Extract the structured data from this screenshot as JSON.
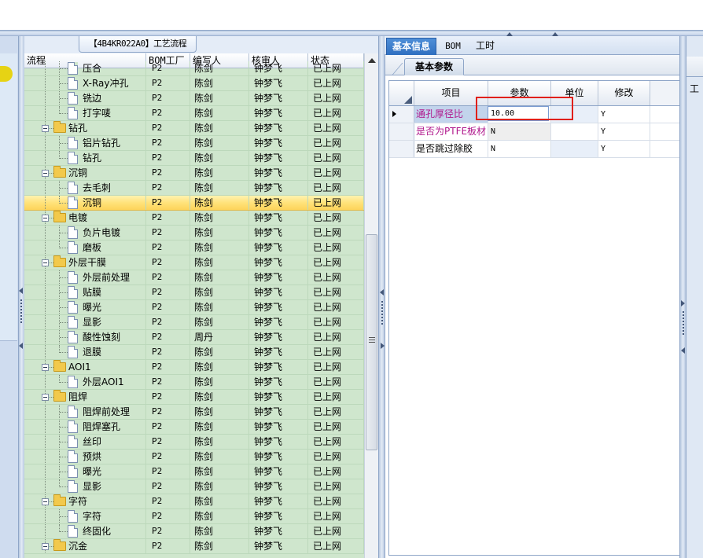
{
  "tree_panel": {
    "title": "【4B4KR022A0】工艺流程",
    "columns": [
      "流程",
      "BOM工厂",
      "编写人",
      "核审人",
      "状态"
    ],
    "rows": [
      {
        "name": "压合",
        "level": 2,
        "type": "doc",
        "factory": "P2",
        "writer": "陈剑",
        "reviewer": "钟梦飞",
        "status": "已上网",
        "partial": true
      },
      {
        "name": "X-Ray冲孔",
        "level": 2,
        "type": "doc",
        "factory": "P2",
        "writer": "陈剑",
        "reviewer": "钟梦飞",
        "status": "已上网"
      },
      {
        "name": "铣边",
        "level": 2,
        "type": "doc",
        "factory": "P2",
        "writer": "陈剑",
        "reviewer": "钟梦飞",
        "status": "已上网"
      },
      {
        "name": "打字唛",
        "level": 2,
        "type": "doc",
        "factory": "P2",
        "writer": "陈剑",
        "reviewer": "钟梦飞",
        "status": "已上网",
        "last": true
      },
      {
        "name": "钻孔",
        "level": 1,
        "type": "folder",
        "factory": "P2",
        "writer": "陈剑",
        "reviewer": "钟梦飞",
        "status": "已上网"
      },
      {
        "name": "铝片钻孔",
        "level": 2,
        "type": "doc",
        "factory": "P2",
        "writer": "陈剑",
        "reviewer": "钟梦飞",
        "status": "已上网"
      },
      {
        "name": "钻孔",
        "level": 2,
        "type": "doc",
        "factory": "P2",
        "writer": "陈剑",
        "reviewer": "钟梦飞",
        "status": "已上网",
        "last": true
      },
      {
        "name": "沉铜",
        "level": 1,
        "type": "folder",
        "factory": "P2",
        "writer": "陈剑",
        "reviewer": "钟梦飞",
        "status": "已上网"
      },
      {
        "name": "去毛刺",
        "level": 2,
        "type": "doc",
        "factory": "P2",
        "writer": "陈剑",
        "reviewer": "钟梦飞",
        "status": "已上网"
      },
      {
        "name": "沉铜",
        "level": 2,
        "type": "doc",
        "factory": "P2",
        "writer": "陈剑",
        "reviewer": "钟梦飞",
        "status": "已上网",
        "last": true,
        "selected": true
      },
      {
        "name": "电镀",
        "level": 1,
        "type": "folder",
        "factory": "P2",
        "writer": "陈剑",
        "reviewer": "钟梦飞",
        "status": "已上网"
      },
      {
        "name": "负片电镀",
        "level": 2,
        "type": "doc",
        "factory": "P2",
        "writer": "陈剑",
        "reviewer": "钟梦飞",
        "status": "已上网"
      },
      {
        "name": "磨板",
        "level": 2,
        "type": "doc",
        "factory": "P2",
        "writer": "陈剑",
        "reviewer": "钟梦飞",
        "status": "已上网",
        "last": true
      },
      {
        "name": "外层干膜",
        "level": 1,
        "type": "folder",
        "factory": "P2",
        "writer": "陈剑",
        "reviewer": "钟梦飞",
        "status": "已上网"
      },
      {
        "name": "外层前处理",
        "level": 2,
        "type": "doc",
        "factory": "P2",
        "writer": "陈剑",
        "reviewer": "钟梦飞",
        "status": "已上网"
      },
      {
        "name": "贴膜",
        "level": 2,
        "type": "doc",
        "factory": "P2",
        "writer": "陈剑",
        "reviewer": "钟梦飞",
        "status": "已上网"
      },
      {
        "name": "曝光",
        "level": 2,
        "type": "doc",
        "factory": "P2",
        "writer": "陈剑",
        "reviewer": "钟梦飞",
        "status": "已上网"
      },
      {
        "name": "显影",
        "level": 2,
        "type": "doc",
        "factory": "P2",
        "writer": "陈剑",
        "reviewer": "钟梦飞",
        "status": "已上网"
      },
      {
        "name": "酸性蚀刻",
        "level": 2,
        "type": "doc",
        "factory": "P2",
        "writer": "周丹",
        "reviewer": "钟梦飞",
        "status": "已上网"
      },
      {
        "name": "退膜",
        "level": 2,
        "type": "doc",
        "factory": "P2",
        "writer": "陈剑",
        "reviewer": "钟梦飞",
        "status": "已上网",
        "last": true
      },
      {
        "name": "AOI1",
        "level": 1,
        "type": "folder",
        "factory": "P2",
        "writer": "陈剑",
        "reviewer": "钟梦飞",
        "status": "已上网"
      },
      {
        "name": "外层AOI1",
        "level": 2,
        "type": "doc",
        "factory": "P2",
        "writer": "陈剑",
        "reviewer": "钟梦飞",
        "status": "已上网",
        "last": true
      },
      {
        "name": "阻焊",
        "level": 1,
        "type": "folder",
        "factory": "P2",
        "writer": "陈剑",
        "reviewer": "钟梦飞",
        "status": "已上网"
      },
      {
        "name": "阻焊前处理",
        "level": 2,
        "type": "doc",
        "factory": "P2",
        "writer": "陈剑",
        "reviewer": "钟梦飞",
        "status": "已上网"
      },
      {
        "name": "阻焊塞孔",
        "level": 2,
        "type": "doc",
        "factory": "P2",
        "writer": "陈剑",
        "reviewer": "钟梦飞",
        "status": "已上网"
      },
      {
        "name": "丝印",
        "level": 2,
        "type": "doc",
        "factory": "P2",
        "writer": "陈剑",
        "reviewer": "钟梦飞",
        "status": "已上网"
      },
      {
        "name": "预烘",
        "level": 2,
        "type": "doc",
        "factory": "P2",
        "writer": "陈剑",
        "reviewer": "钟梦飞",
        "status": "已上网"
      },
      {
        "name": "曝光",
        "level": 2,
        "type": "doc",
        "factory": "P2",
        "writer": "陈剑",
        "reviewer": "钟梦飞",
        "status": "已上网"
      },
      {
        "name": "显影",
        "level": 2,
        "type": "doc",
        "factory": "P2",
        "writer": "陈剑",
        "reviewer": "钟梦飞",
        "status": "已上网",
        "last": true
      },
      {
        "name": "字符",
        "level": 1,
        "type": "folder",
        "factory": "P2",
        "writer": "陈剑",
        "reviewer": "钟梦飞",
        "status": "已上网"
      },
      {
        "name": "字符",
        "level": 2,
        "type": "doc",
        "factory": "P2",
        "writer": "陈剑",
        "reviewer": "钟梦飞",
        "status": "已上网"
      },
      {
        "name": "终固化",
        "level": 2,
        "type": "doc",
        "factory": "P2",
        "writer": "陈剑",
        "reviewer": "钟梦飞",
        "status": "已上网",
        "last": true
      },
      {
        "name": "沉金",
        "level": 1,
        "type": "folder",
        "factory": "P2",
        "writer": "陈剑",
        "reviewer": "钟梦飞",
        "status": "已上网"
      }
    ]
  },
  "detail_panel": {
    "tabs": [
      {
        "label": "基本信息",
        "active": true
      },
      {
        "label": "BOM",
        "active": false
      },
      {
        "label": "工时",
        "active": false
      }
    ],
    "subtab": "基本参数",
    "grid_columns": [
      "项目",
      "参数",
      "单位",
      "修改"
    ],
    "params": [
      {
        "item": "通孔厚径比",
        "value": "10.00",
        "unit": "",
        "modified": "Y",
        "current": true
      },
      {
        "item": "是否为PTFE板材",
        "value": "N",
        "unit": "",
        "modified": "Y"
      },
      {
        "item": "是否跳过除胶",
        "value": "N",
        "unit": "",
        "modified": "Y"
      }
    ]
  },
  "far_panel": {
    "label": "工"
  },
  "colors": {
    "tree_background": "#cfe6cd",
    "selection_highlight": "#ffe27a",
    "active_tab": "#2f6fc0",
    "param_label_magenta": "#b0178c",
    "annotation_box": "#e0201a"
  }
}
